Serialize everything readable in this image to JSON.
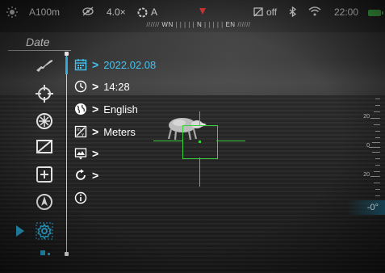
{
  "status_bar": {
    "range": "A100m",
    "zoom": "4.0×",
    "mode": "A",
    "compass_left": "WN",
    "compass_center": "N",
    "compass_right": "EN",
    "wifi_hotspot": "off",
    "time": "22:00"
  },
  "menu": {
    "title": "Date",
    "categories": [
      {
        "icon": "rifle-icon"
      },
      {
        "icon": "crosshair-icon"
      },
      {
        "icon": "aperture-icon"
      },
      {
        "icon": "display-off-icon"
      },
      {
        "icon": "plus-box-icon"
      },
      {
        "icon": "compass-icon"
      },
      {
        "icon": "settings-gear-icon",
        "selected": true
      }
    ],
    "items": [
      {
        "icon": "calendar-icon",
        "label": "2022.02.08",
        "active": true
      },
      {
        "icon": "clock-icon",
        "label": "14:28"
      },
      {
        "icon": "globe-icon",
        "label": "English"
      },
      {
        "icon": "units-icon",
        "label": "Meters"
      },
      {
        "icon": "image-export-icon",
        "label": ""
      },
      {
        "icon": "reset-icon",
        "label": ""
      },
      {
        "icon": "info-icon",
        "label": ""
      }
    ]
  },
  "tilt_scale": {
    "labels": [
      "20",
      "0",
      "20"
    ],
    "current": "-0°"
  },
  "colors": {
    "accent": "#2fb6e6",
    "reticle": "#39d23c",
    "compass_marker": "#e23b3b",
    "battery": "#49c24d"
  }
}
